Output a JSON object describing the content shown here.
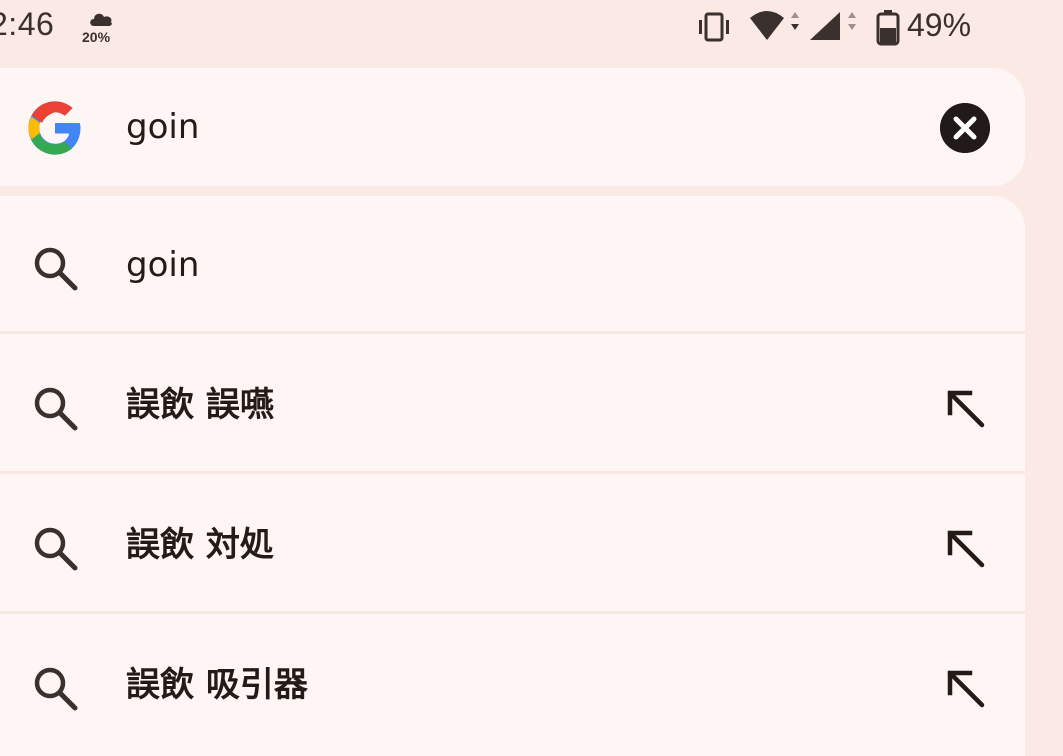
{
  "status_bar": {
    "time": "2:46",
    "weather_icon": "cloud-rain-icon",
    "precip_chance": "20%",
    "vibrate_icon": "vibrate-icon",
    "wifi_icon": "wifi-icon",
    "cell_icon": "cell-signal-icon",
    "battery_icon": "battery-icon",
    "battery_percent": "49%"
  },
  "search": {
    "logo": "google-g-icon",
    "query": "goin",
    "clear_icon": "close-circle-icon"
  },
  "suggestions": [
    {
      "text": "goin",
      "bold": false,
      "fill_icon": false
    },
    {
      "text": "誤飲 誤嚥",
      "bold": true,
      "fill_icon": true
    },
    {
      "text": "誤飲 対処",
      "bold": true,
      "fill_icon": true
    },
    {
      "text": "誤飲 吸引器",
      "bold": true,
      "fill_icon": true
    }
  ],
  "colors": {
    "background": "#fbe9e5",
    "surface": "#fef6f4",
    "text": "#241a18",
    "google_blue": "#4285f4",
    "google_red": "#ea4335",
    "google_yellow": "#fbbc05",
    "google_green": "#34a853"
  }
}
